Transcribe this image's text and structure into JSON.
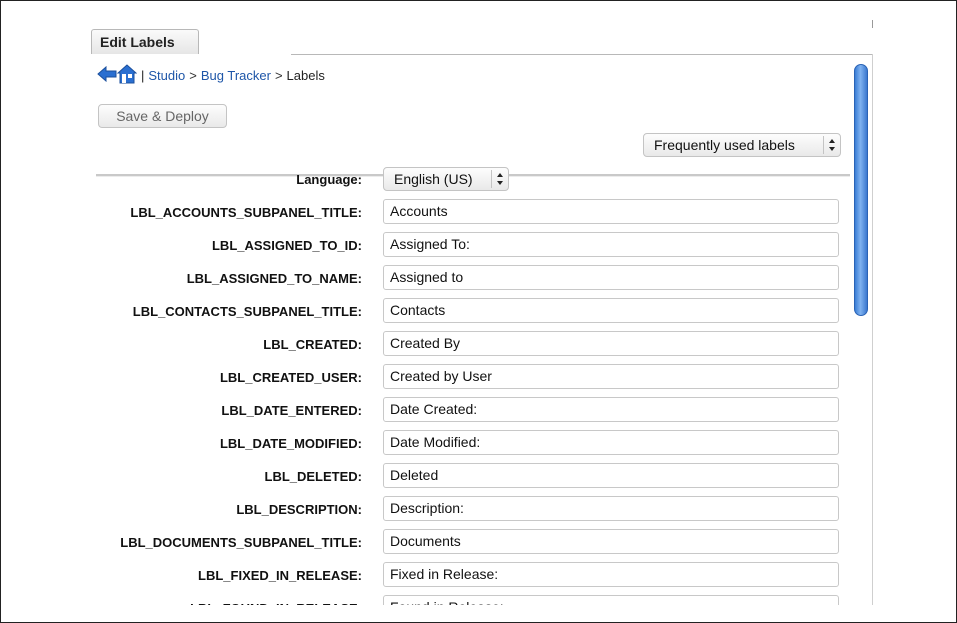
{
  "tab": {
    "label": "Edit Labels"
  },
  "breadcrumb": {
    "separator_pipe": "|",
    "studio": "Studio",
    "arrow1": ">",
    "module": "Bug Tracker",
    "arrow2": ">",
    "current": "Labels"
  },
  "toolbar": {
    "save_deploy_label": "Save & Deploy",
    "filter_select": {
      "selected": "Frequently used labels"
    }
  },
  "language": {
    "label": "Language:",
    "selected": "English (US)"
  },
  "labels": [
    {
      "key": "LBL_ACCOUNTS_SUBPANEL_TITLE:",
      "value": "Accounts"
    },
    {
      "key": "LBL_ASSIGNED_TO_ID:",
      "value": "Assigned To:"
    },
    {
      "key": "LBL_ASSIGNED_TO_NAME:",
      "value": "Assigned to"
    },
    {
      "key": "LBL_CONTACTS_SUBPANEL_TITLE:",
      "value": "Contacts"
    },
    {
      "key": "LBL_CREATED:",
      "value": "Created By"
    },
    {
      "key": "LBL_CREATED_USER:",
      "value": "Created by User"
    },
    {
      "key": "LBL_DATE_ENTERED:",
      "value": "Date Created:"
    },
    {
      "key": "LBL_DATE_MODIFIED:",
      "value": "Date Modified:"
    },
    {
      "key": "LBL_DELETED:",
      "value": "Deleted"
    },
    {
      "key": "LBL_DESCRIPTION:",
      "value": "Description:"
    },
    {
      "key": "LBL_DOCUMENTS_SUBPANEL_TITLE:",
      "value": "Documents"
    },
    {
      "key": "LBL_FIXED_IN_RELEASE:",
      "value": "Fixed in Release:"
    },
    {
      "key": "LBL_FOUND_IN_RELEASE:",
      "value": "Found in Release:"
    }
  ],
  "icons": {
    "back": "back-arrow-icon",
    "home": "home-icon",
    "updown": "updown-arrows-icon"
  },
  "colors": {
    "link": "#1e56a8",
    "scroll_thumb": "#4a8ae0"
  }
}
